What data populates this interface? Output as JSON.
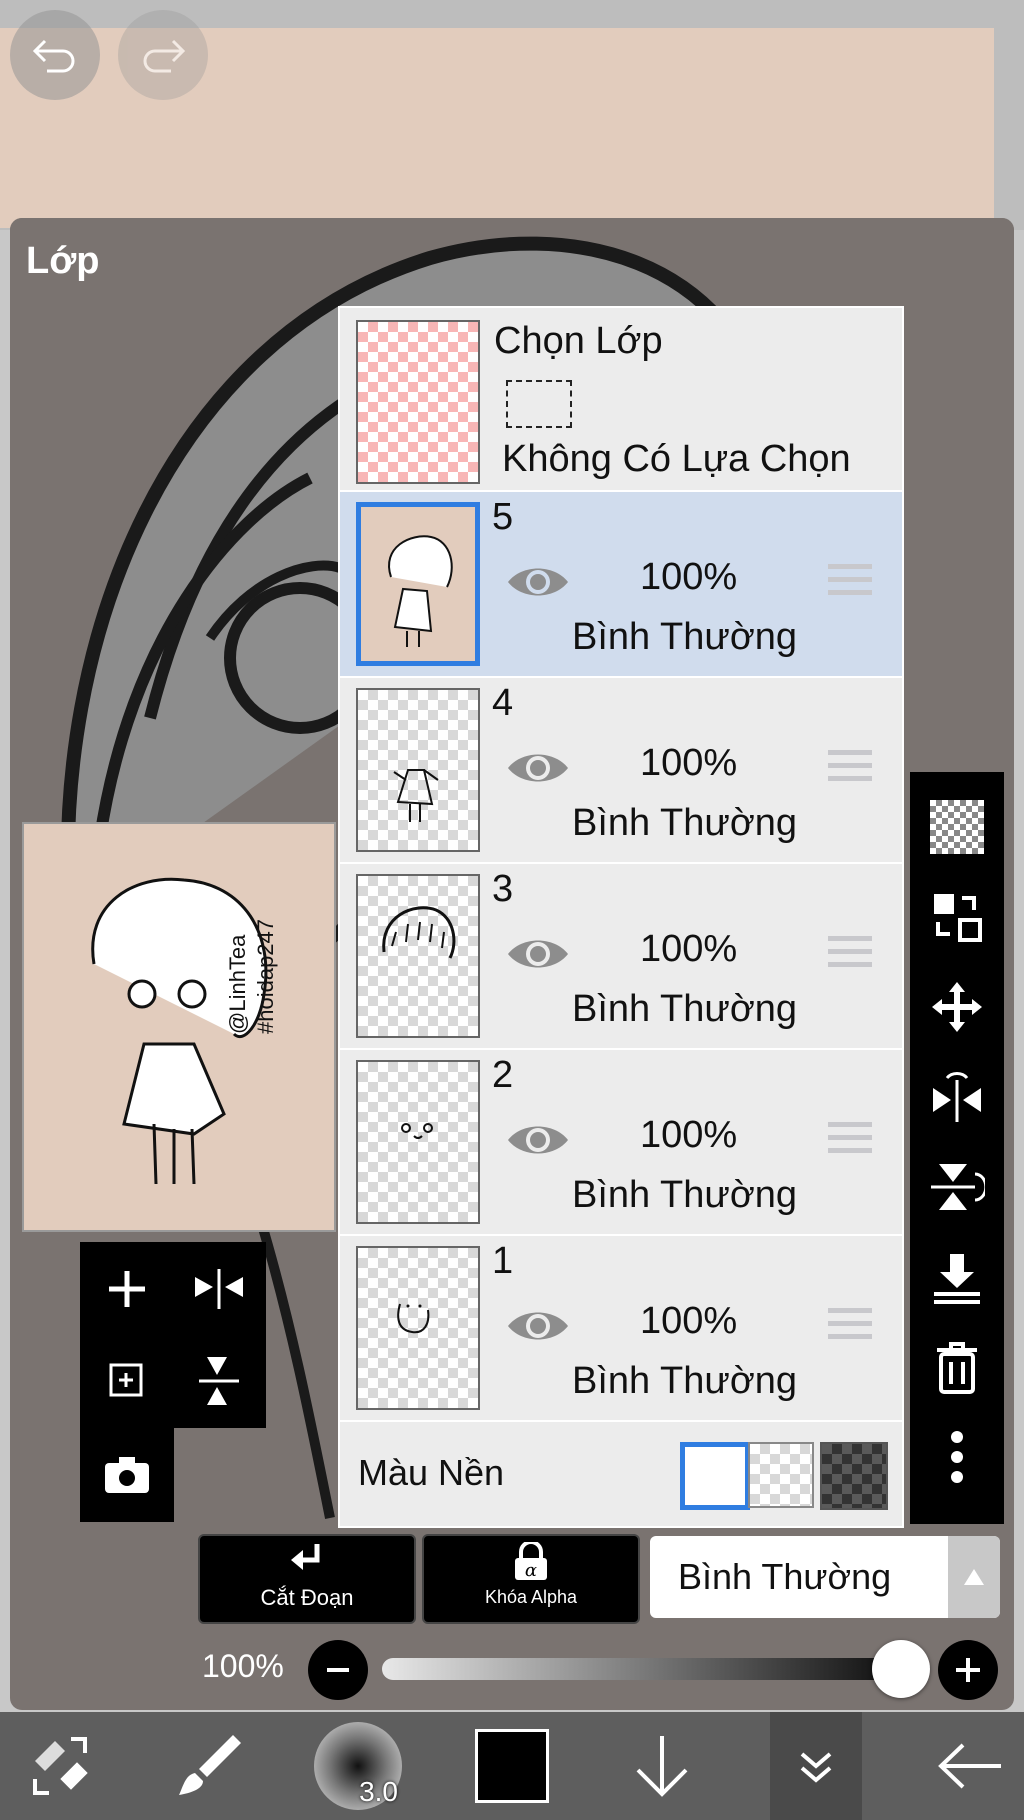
{
  "panel": {
    "title": "Lớp"
  },
  "selection_layer": {
    "title": "Chọn Lớp",
    "status": "Không Có Lựa Chọn"
  },
  "layers": [
    {
      "number": "5",
      "opacity": "100%",
      "blend": "Bình Thường",
      "selected": true
    },
    {
      "number": "4",
      "opacity": "100%",
      "blend": "Bình Thường",
      "selected": false
    },
    {
      "number": "3",
      "opacity": "100%",
      "blend": "Bình Thường",
      "selected": false
    },
    {
      "number": "2",
      "opacity": "100%",
      "blend": "Bình Thường",
      "selected": false
    },
    {
      "number": "1",
      "opacity": "100%",
      "blend": "Bình Thường",
      "selected": false
    }
  ],
  "background": {
    "label": "Màu Nền",
    "options": [
      "white",
      "transparent",
      "dark-checker"
    ],
    "selected": "white"
  },
  "preview": {
    "watermark_1": "@LinhTea",
    "watermark_2": "#hoidap247"
  },
  "controls": {
    "clipping_label": "Cắt Đoạn",
    "alpha_lock_label": "Khóa Alpha",
    "blend_mode": "Bình Thường",
    "opacity_label": "100%",
    "opacity_value": 1.0
  },
  "bottom_bar": {
    "brush_size": "3.0",
    "current_color": "#000000"
  },
  "colors": {
    "accent": "#2f7de1",
    "selected_row": "#d0dced",
    "panel": "#7a7370"
  }
}
